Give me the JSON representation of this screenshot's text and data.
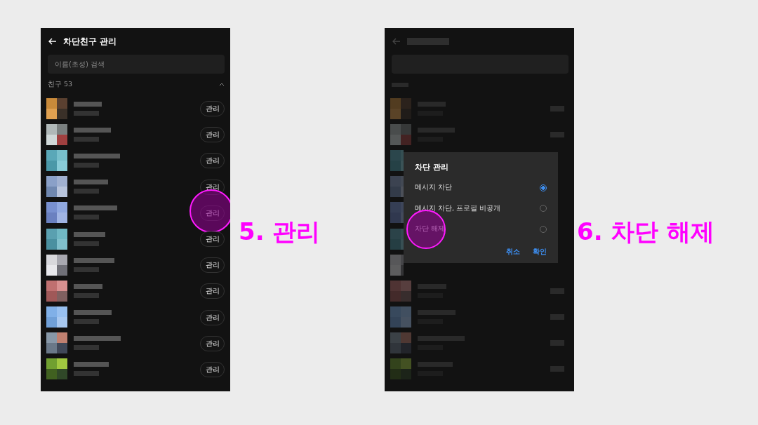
{
  "list_screen": {
    "title": "차단친구 관리",
    "search": {
      "placeholder": "이름(초성) 검색"
    },
    "section": {
      "label": "친구 53",
      "expanded": true
    },
    "rows": [
      {
        "button": "관리",
        "highlighted": false
      },
      {
        "button": "관리",
        "highlighted": false
      },
      {
        "button": "관리",
        "highlighted": false
      },
      {
        "button": "관리",
        "highlighted": false
      },
      {
        "button": "관리",
        "highlighted": true
      },
      {
        "button": "관리",
        "highlighted": false
      },
      {
        "button": "관리",
        "highlighted": false
      },
      {
        "button": "관리",
        "highlighted": false
      },
      {
        "button": "관리",
        "highlighted": false
      },
      {
        "button": "관리",
        "highlighted": false
      },
      {
        "button": "관리",
        "highlighted": false
      }
    ]
  },
  "step_labels": [
    "5. 관리",
    "6. 차단 해제"
  ],
  "dialog": {
    "title": "차단 관리",
    "options": [
      {
        "label": "메시지 차단",
        "selected": true,
        "highlighted": false
      },
      {
        "label": "메시지 차단, 프로필 비공개",
        "selected": false,
        "highlighted": false
      },
      {
        "label": "차단 해제",
        "selected": false,
        "highlighted": true
      }
    ],
    "buttons": [
      "취소",
      "확인"
    ]
  }
}
